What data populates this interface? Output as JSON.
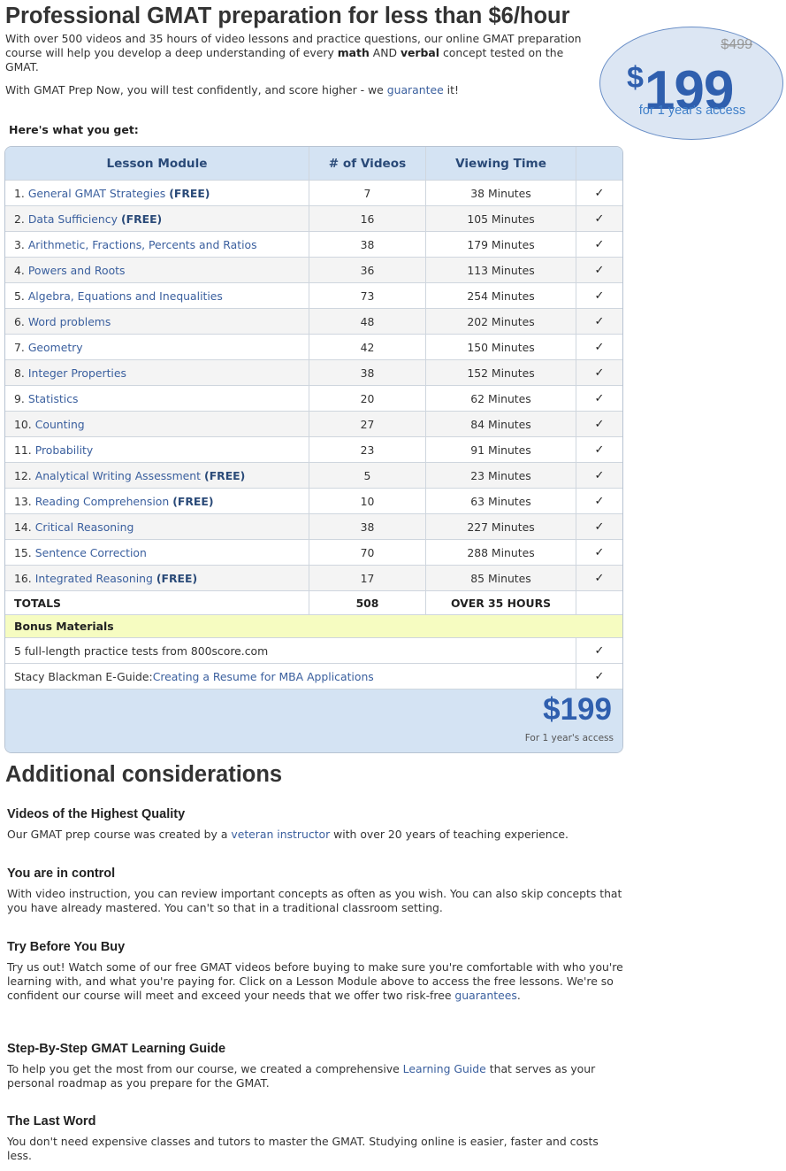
{
  "hero": {
    "title": "Professional GMAT preparation for less than $6/hour",
    "intro_a": "With over 500 videos and 35 hours of video lessons and practice questions, our online GMAT preparation course will help you develop a deep understanding of every ",
    "intro_math": "math",
    "intro_and": " AND ",
    "intro_verbal": "verbal",
    "intro_b": " concept tested on the GMAT.",
    "guarantee_pre": "With GMAT Prep Now, you will test confidently, and score higher - we ",
    "guarantee_link": "guarantee",
    "guarantee_post": " it!"
  },
  "price_badge": {
    "old_price": "$499",
    "currency": "$",
    "amount": "199",
    "access": "for 1 year's access"
  },
  "what_label": "Here's what you get:",
  "table": {
    "headers": [
      "Lesson Module",
      "# of Videos",
      "Viewing Time",
      ""
    ],
    "check": "✓",
    "free_tag": "(FREE)",
    "rows": [
      {
        "num": "1.",
        "name": "General GMAT Strategies",
        "free": true,
        "videos": "7",
        "time": "38 Minutes"
      },
      {
        "num": "2.",
        "name": "Data Sufficiency",
        "free": true,
        "videos": "16",
        "time": "105 Minutes"
      },
      {
        "num": "3.",
        "name": "Arithmetic, Fractions, Percents and Ratios",
        "free": false,
        "videos": "38",
        "time": "179 Minutes"
      },
      {
        "num": "4.",
        "name": "Powers and Roots",
        "free": false,
        "videos": "36",
        "time": "113 Minutes"
      },
      {
        "num": "5.",
        "name": "Algebra, Equations and Inequalities",
        "free": false,
        "videos": "73",
        "time": "254 Minutes"
      },
      {
        "num": "6.",
        "name": "Word problems",
        "free": false,
        "videos": "48",
        "time": "202 Minutes"
      },
      {
        "num": "7.",
        "name": "Geometry",
        "free": false,
        "videos": "42",
        "time": "150 Minutes"
      },
      {
        "num": "8.",
        "name": "Integer Properties",
        "free": false,
        "videos": "38",
        "time": "152 Minutes"
      },
      {
        "num": "9.",
        "name": "Statistics",
        "free": false,
        "videos": "20",
        "time": "62 Minutes"
      },
      {
        "num": "10.",
        "name": "Counting",
        "free": false,
        "videos": "27",
        "time": "84 Minutes"
      },
      {
        "num": "11.",
        "name": "Probability",
        "free": false,
        "videos": "23",
        "time": "91 Minutes"
      },
      {
        "num": "12.",
        "name": "Analytical Writing Assessment",
        "free": true,
        "videos": "5",
        "time": "23 Minutes"
      },
      {
        "num": "13.",
        "name": "Reading Comprehension",
        "free": true,
        "videos": "10",
        "time": "63 Minutes"
      },
      {
        "num": "14.",
        "name": "Critical Reasoning",
        "free": false,
        "videos": "38",
        "time": "227 Minutes"
      },
      {
        "num": "15.",
        "name": "Sentence Correction",
        "free": false,
        "videos": "70",
        "time": "288 Minutes"
      },
      {
        "num": "16.",
        "name": "Integrated Reasoning",
        "free": true,
        "videos": "17",
        "time": "85 Minutes"
      }
    ],
    "totals": {
      "label": "TOTALS",
      "videos": "508",
      "time": "OVER 35 HOURS"
    },
    "bonus_label": "Bonus Materials",
    "bonus": [
      {
        "text": "5 full-length practice tests from 800score.com",
        "link": ""
      },
      {
        "text": "Stacy Blackman E-Guide: ",
        "link": "Creating a Resume for MBA Applications"
      }
    ],
    "footer_price": "$199",
    "footer_access": "For 1 year's access"
  },
  "additional": {
    "title": "Additional considerations",
    "sections": [
      {
        "heading": "Videos of the Highest Quality",
        "pre": "Our GMAT prep course was created by a ",
        "link": "veteran instructor",
        "post": " with over 20 years of teaching experience."
      },
      {
        "heading": "You are in control",
        "pre": "With video instruction, you can review important concepts as often as you wish. You can also skip concepts that you have already mastered. You can't so that in a traditional classroom setting.",
        "link": "",
        "post": ""
      },
      {
        "heading": "Try Before You Buy",
        "pre": "Try us out! Watch some of our free GMAT videos before buying to make sure you're comfortable with who you're learning with, and what you're paying for. Click on a Lesson Module above to access the free lessons. We're so confident our course will meet and exceed your needs that we offer two risk-free ",
        "link": "guarantees",
        "post": "."
      },
      {
        "heading": "Step-By-Step GMAT Learning Guide",
        "pre": "To help you get the most from our course, we created a comprehensive ",
        "link": "Learning Guide",
        "post": " that serves as your personal roadmap as you prepare for the GMAT."
      },
      {
        "heading": "The Last Word",
        "pre": "You don't need expensive classes and tutors to master the GMAT. Studying online is easier, faster and costs less.",
        "link": "",
        "post": ""
      }
    ]
  }
}
